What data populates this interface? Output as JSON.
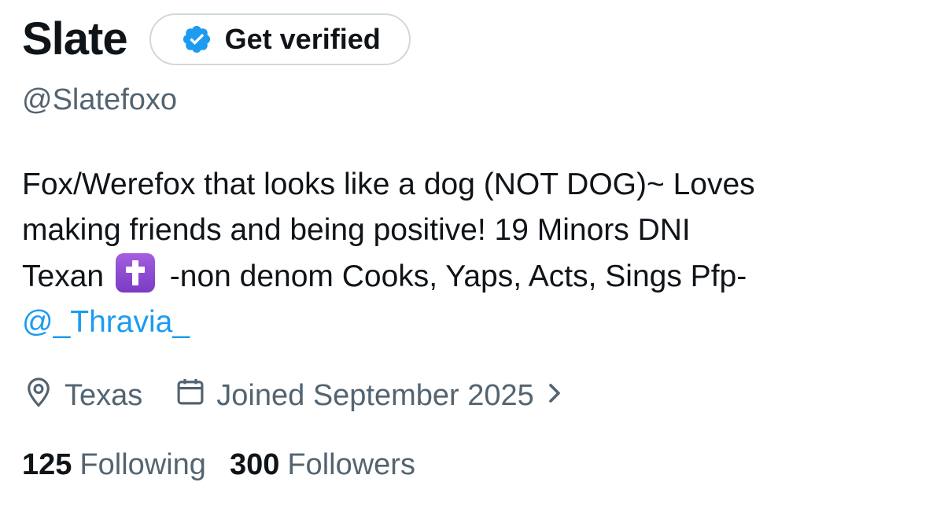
{
  "profile": {
    "display_name": "Slate",
    "verify_button_label": "Get verified",
    "handle": "@Slatefoxo",
    "bio": {
      "line1": "Fox/Werefox that looks like a dog (NOT DOG)~ Loves",
      "line2": "making friends and being positive! 19 Minors DNI",
      "line3_before": "Texan",
      "line3_after": "-non denom Cooks, Yaps, Acts, Sings Pfp-",
      "mention": "@_Thravia_"
    },
    "location": "Texas",
    "joined": "Joined September 2025",
    "following_count": "125",
    "following_label": "Following",
    "followers_count": "300",
    "followers_label": "Followers"
  },
  "colors": {
    "text_primary": "#0f1419",
    "text_secondary": "#536471",
    "link": "#1d9bf0",
    "border": "#cfd9de",
    "verified_badge": "#1d9bf0",
    "emoji_purple": "#8e44d2"
  },
  "icons": {
    "verified": "verified-badge-icon",
    "location": "location-pin-icon",
    "calendar": "calendar-icon",
    "chevron": "chevron-right-icon",
    "cross_emoji": "latin-cross-emoji"
  }
}
